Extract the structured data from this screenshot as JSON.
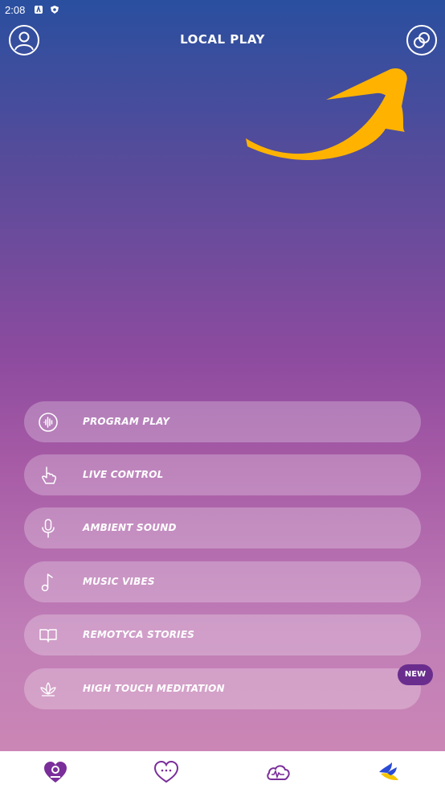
{
  "status_bar": {
    "time": "2:08"
  },
  "header": {
    "title": "LOCAL PLAY"
  },
  "menu": {
    "items": [
      {
        "label": "PROGRAM PLAY",
        "icon": "waveform-icon"
      },
      {
        "label": "LIVE CONTROL",
        "icon": "hand-pointer-icon"
      },
      {
        "label": "AMBIENT SOUND",
        "icon": "microphone-icon"
      },
      {
        "label": "MUSIC VIBES",
        "icon": "music-note-icon"
      },
      {
        "label": "REMOTYCA STORIES",
        "icon": "book-icon"
      },
      {
        "label": "HIGH TOUCH MEDITATION",
        "icon": "lotus-icon"
      }
    ],
    "new_badge": "NEW"
  },
  "bottom_nav": {
    "items": [
      {
        "icon": "heart-location-icon",
        "active": true
      },
      {
        "icon": "heart-chat-icon",
        "active": false
      },
      {
        "icon": "cloud-wave-icon",
        "active": false
      },
      {
        "icon": "ukraine-dove-icon",
        "active": false
      }
    ]
  },
  "colors": {
    "accent_purple": "#7a2e9a",
    "arrow_yellow": "#ffb300",
    "badge_purple": "#6a2d8e"
  }
}
